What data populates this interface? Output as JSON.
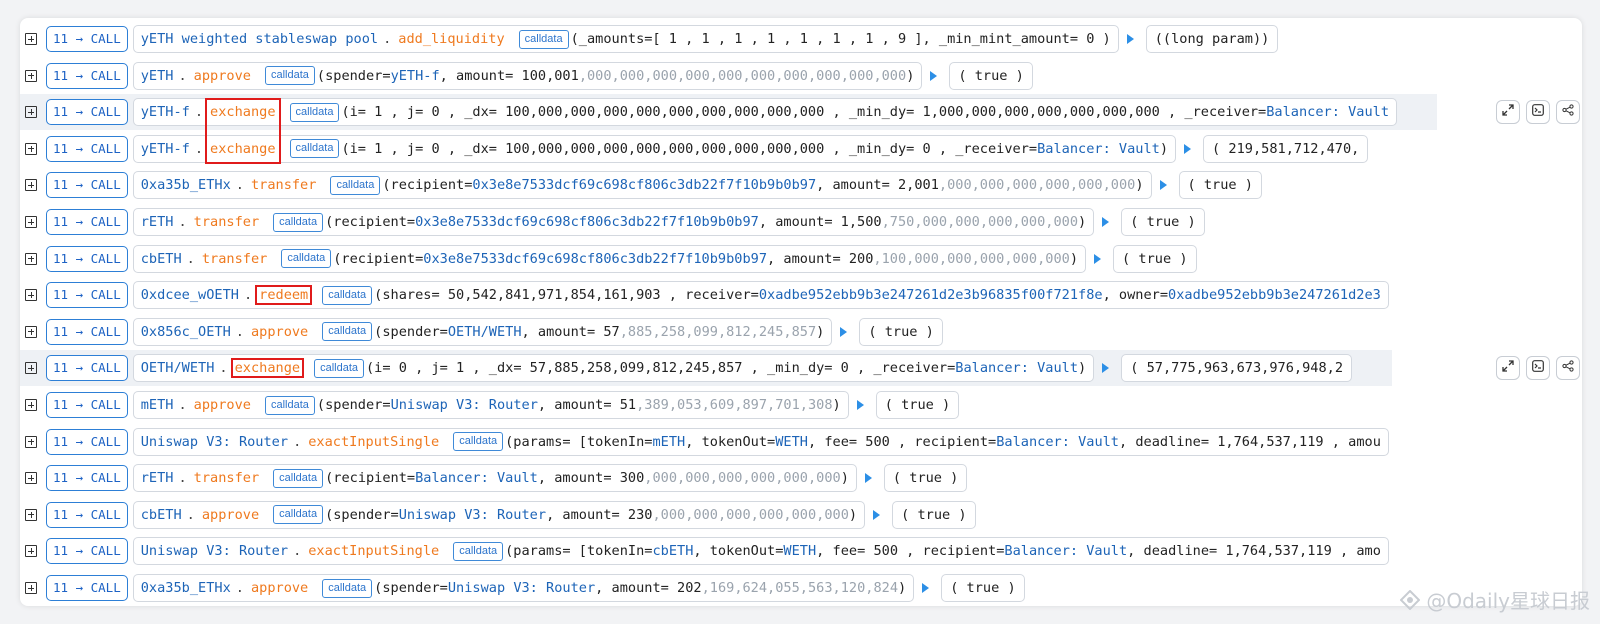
{
  "call_label": "11 → CALL",
  "calldata_label": "calldata",
  "rows": [
    {
      "contract": "yETH weighted stableswap pool",
      "method": "add_liquidity",
      "args": "(_amounts=[ 1 , 1 , 1 , 1 , 1 , 1 , 1 , 9 ], _min_mint_amount= 0 )",
      "ret": "((long param))"
    },
    {
      "contract": "yETH",
      "method": "approve",
      "args_pre": "(spender= ",
      "addr": "yETH-f",
      "args_mid": " , amount= 100,001",
      "args_grey": ",000,000,000,000,000,000,000,000,000,000",
      "args_post": " )",
      "ret": "( true )"
    },
    {
      "contract": "yETH-f",
      "method": "exchange",
      "args": "(i= 1 , j= 0 , _dx= 100,000,000,000,000,000,000,000,000,000 , _min_dy= 1,000,000,000,000,000,000,000 , _receiver=",
      "addr_end": "Balancer: Vault"
    },
    {
      "contract": "yETH-f",
      "method": "exchange",
      "args": "(i= 1 , j= 0 , _dx= 100,000,000,000,000,000,000,000,000,000 , _min_dy= 0 , _receiver=",
      "addr": "Balancer: Vault",
      "args_post": " )",
      "ret": "( 219,581,712,470,"
    },
    {
      "contract": "0xa35b_ETHx",
      "method": "transfer",
      "args_pre": "(recipient= ",
      "addr": "0x3e8e7533dcf69c698cf806c3db22f7f10b9b0b97",
      "args_mid": " , amount= 2,001",
      "args_grey": ",000,000,000,000,000,000",
      "args_post": " )",
      "ret": "( true )"
    },
    {
      "contract": "rETH",
      "method": "transfer",
      "args_pre": "(recipient= ",
      "addr": "0x3e8e7533dcf69c698cf806c3db22f7f10b9b0b97",
      "args_mid": " , amount= 1,500",
      "args_grey": ",750,000,000,000,000,000",
      "args_post": " )",
      "ret": "( true )"
    },
    {
      "contract": "cbETH",
      "method": "transfer",
      "args_pre": "(recipient= ",
      "addr": "0x3e8e7533dcf69c698cf806c3db22f7f10b9b0b97",
      "args_mid": " , amount= 200",
      "args_grey": ",100,000,000,000,000,000",
      "args_post": " )",
      "ret": "( true )"
    },
    {
      "contract": "0xdcee_wOETH",
      "method": "redeem",
      "args": "(shares= 50,542,841,971,854,161,903 , receiver= ",
      "addr": "0xadbe952ebb9b3e247261d2e3b96835f00f721f8e",
      "args_post": " , owner= ",
      "addr2": "0xadbe952ebb9b3e247261d2e3"
    },
    {
      "contract": "0x856c_OETH",
      "method": "approve",
      "args_pre": "(spender= ",
      "addr": "OETH/WETH",
      "args_mid": " , amount= 57",
      "args_grey": ",885,258,099,812,245,857",
      "args_post": " )",
      "ret": "( true )"
    },
    {
      "contract": "OETH/WETH",
      "method": "exchange",
      "args": "(i= 0 , j= 1 , _dx= 57,885,258,099,812,245,857 , _min_dy= 0 , _receiver= ",
      "addr": "Balancer: Vault",
      "args_post": " )",
      "ret": "( 57,775,963,673,976,948,2"
    },
    {
      "contract": "mETH",
      "method": "approve",
      "args_pre": "(spender= ",
      "addr": "Uniswap V3: Router",
      "args_mid": " , amount= 51",
      "args_grey": ",389,053,609,897,701,308",
      "args_post": " )",
      "ret": "( true )"
    },
    {
      "contract": "Uniswap V3: Router",
      "method": "exactInputSingle",
      "args": "(params= [tokenIn= ",
      "addr": "mETH",
      "args_mid": " , tokenOut= ",
      "addr2": "WETH",
      "args_post": " , fee= 500 , recipient= ",
      "addr3": "Balancer: Vault",
      "args_tail": " , deadline= 1,764,537,119 , amou"
    },
    {
      "contract": "rETH",
      "method": "transfer",
      "args_pre": "(recipient= ",
      "addr": "Balancer: Vault",
      "args_mid": " , amount= 300",
      "args_grey": ",000,000,000,000,000,000",
      "args_post": " )",
      "ret": "( true )"
    },
    {
      "contract": "cbETH",
      "method": "approve",
      "args_pre": "(spender= ",
      "addr": "Uniswap V3: Router",
      "args_mid": " , amount= 230",
      "args_grey": ",000,000,000,000,000,000",
      "args_post": " )",
      "ret": "( true )"
    },
    {
      "contract": "Uniswap V3: Router",
      "method": "exactInputSingle",
      "args": "(params= [tokenIn= ",
      "addr": "cbETH",
      "args_mid": " , tokenOut= ",
      "addr2": "WETH",
      "args_post": " , fee= 500 , recipient= ",
      "addr3": "Balancer: Vault",
      "args_tail": " , deadline= 1,764,537,119 , amo"
    },
    {
      "contract": "0xa35b_ETHx",
      "method": "approve",
      "args_pre": "(spender= ",
      "addr": "Uniswap V3: Router",
      "args_mid": " , amount= 202",
      "args_grey": ",169,624,055,563,120,824",
      "args_post": " )",
      "ret": "( true )"
    }
  ],
  "watermark": "@Odaily星球日报"
}
